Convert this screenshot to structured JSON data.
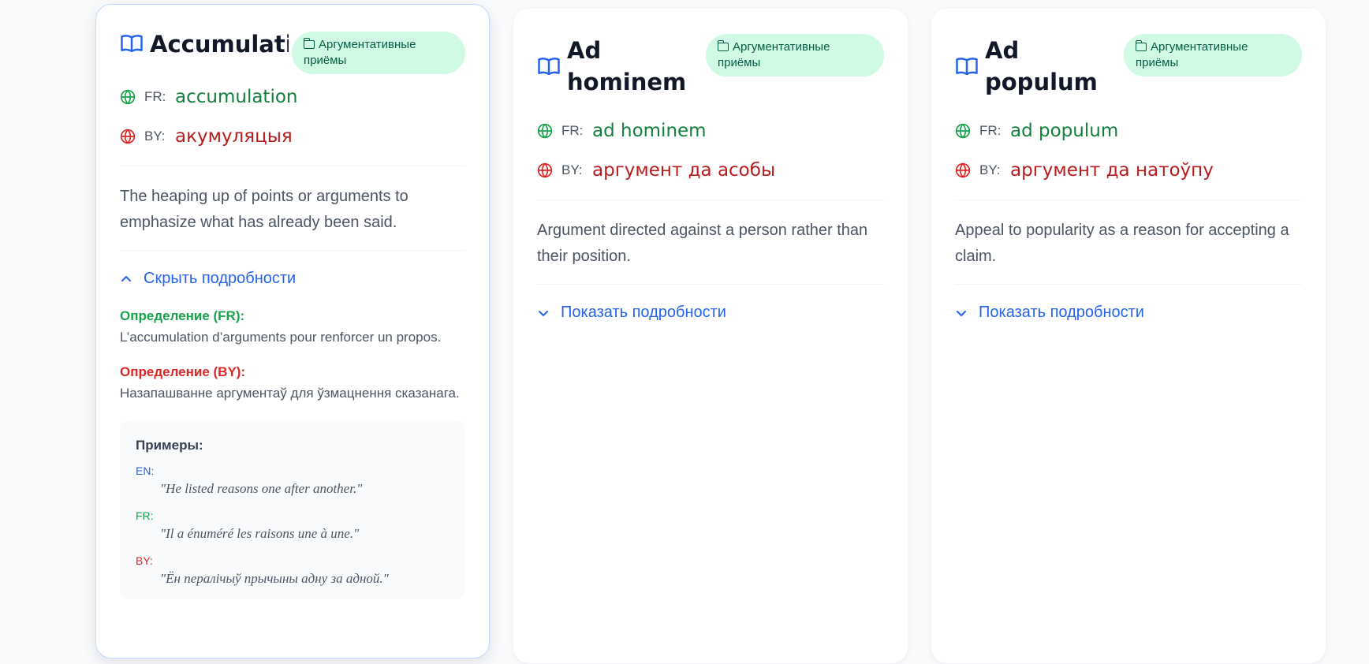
{
  "cards": [
    {
      "term": "Accumulation",
      "category": "Аргументативные приёмы",
      "fr_code": "FR:",
      "fr_word": "accumulation",
      "by_code": "BY:",
      "by_word": "акумуляцыя",
      "description": "The heaping up of points or arguments to emphasize what has already been said.",
      "toggle_label": "Скрыть подробности",
      "expanded": true,
      "def_fr_label": "Определение (FR):",
      "def_fr_text": "L’accumulation d’arguments pour renforcer un propos.",
      "def_by_label": "Определение (BY):",
      "def_by_text": "Назапашванне аргументаў для ўзмацнення сказанага.",
      "examples_title": "Примеры:",
      "ex_en_label": "EN:",
      "ex_en_text": "\"He listed reasons one after another.\"",
      "ex_fr_label": "FR:",
      "ex_fr_text": "\"Il a énuméré les raisons une à une.\"",
      "ex_by_label": "BY:",
      "ex_by_text": "\"Ён пералічыў прычыны адну за адной.\""
    },
    {
      "term": "Ad hominem",
      "category": "Аргументативные приёмы",
      "fr_code": "FR:",
      "fr_word": "ad hominem",
      "by_code": "BY:",
      "by_word": "аргумент да асобы",
      "description": "Argument directed against a person rather than their position.",
      "toggle_label": "Показать подробности",
      "expanded": false
    },
    {
      "term": "Ad populum",
      "category": "Аргументативные приёмы",
      "fr_code": "FR:",
      "fr_word": "ad populum",
      "by_code": "BY:",
      "by_word": "аргумент да натоўпу",
      "description": "Appeal to popularity as a reason for accepting a claim.",
      "toggle_label": "Показать подробности",
      "expanded": false
    }
  ],
  "colors": {
    "accent": "#2563eb",
    "fr": "#15803d",
    "by": "#b91c1c",
    "badge_bg": "#d1fae5"
  }
}
